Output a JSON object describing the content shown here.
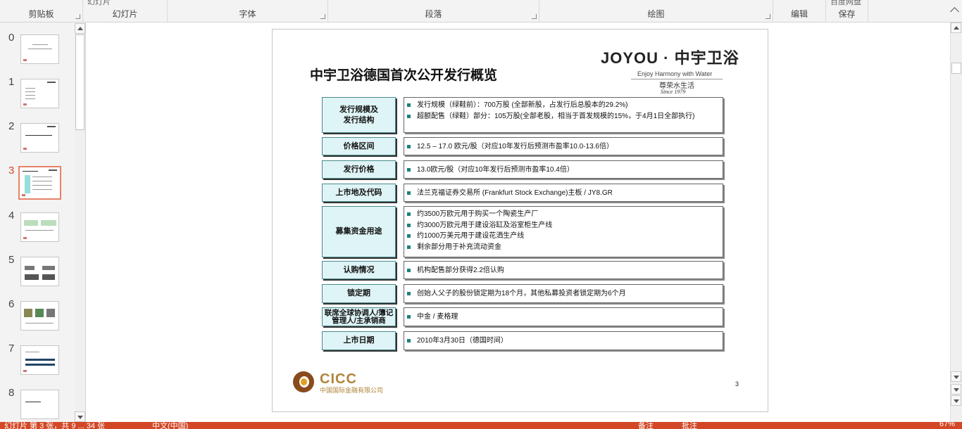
{
  "ribbon": {
    "groups": [
      {
        "label": "剪贴板"
      },
      {
        "label": "幻灯片"
      },
      {
        "label": "字体"
      },
      {
        "label": "段落"
      },
      {
        "label": "绘图"
      },
      {
        "label": "编辑"
      },
      {
        "label": "保存"
      }
    ],
    "partial_texts": {
      "slides_top": "幻灯片",
      "save_top": "百度网盘"
    }
  },
  "thumbnails": {
    "items": [
      {
        "num": "0"
      },
      {
        "num": "1"
      },
      {
        "num": "2"
      },
      {
        "num": "3"
      },
      {
        "num": "4"
      },
      {
        "num": "5"
      },
      {
        "num": "6"
      },
      {
        "num": "7"
      },
      {
        "num": "8"
      }
    ],
    "active_index": 3
  },
  "slide": {
    "title": "中宇卫浴德国首次公开发行概览",
    "brand": "JOYOU · 中宇卫浴",
    "tagline": "Enjoy Harmony with Water",
    "subtag": "尊荣水生活",
    "since": "Since 1979",
    "rows": [
      {
        "label": "发行规模及\n发行结构",
        "bullets": [
          "发行规模（绿鞋前）：700万股 (全部新股，占发行后总股本的29.2%)",
          "超额配售（绿鞋）部分：105万股(全部老股，相当于首发规模的15%，于4月1日全部执行)"
        ]
      },
      {
        "label": "价格区间",
        "bullets": [
          "12.5 – 17.0 欧元/股（对应10年发行后预测市盈率10.0-13.6倍）"
        ]
      },
      {
        "label": "发行价格",
        "bullets": [
          "13.0欧元/股（对应10年发行后预测市盈率10.4倍）"
        ]
      },
      {
        "label": "上市地及代码",
        "bullets": [
          "法兰克福证券交易所 (Frankfurt Stock Exchange)主板 / JY8.GR"
        ]
      },
      {
        "label": "募集资金用途",
        "bullets": [
          "约3500万欧元用于购买一个陶瓷生产厂",
          "约3000万欧元用于建设浴缸及浴室柜生产线",
          "约1000万美元用于建设花洒生产线",
          "剩余部分用于补充流动资金"
        ]
      },
      {
        "label": "认购情况",
        "bullets": [
          "机构配售部分获得2.2倍认购"
        ]
      },
      {
        "label": "锁定期",
        "bullets": [
          "创始人父子的股份锁定期为18个月，其他私募投资者锁定期为6个月"
        ]
      },
      {
        "label": "联席全球协调人/簿记管理人/主承销商",
        "bullets": [
          "中金 / 麦格理"
        ]
      },
      {
        "label": "上市日期",
        "bullets": [
          "2010年3月30日（德国时间）"
        ]
      }
    ],
    "footer": {
      "cicc_name": "CICC",
      "cicc_cn": "中国国际金融有限公司",
      "page_number": "3"
    }
  },
  "status": {
    "slide_info": "幻灯片 第 3 张，共 9 ... 34 张",
    "language": "中文(中国)",
    "notes": "备注",
    "comments": "批注",
    "zoom": "67%"
  },
  "colors": {
    "accent": "#d24726",
    "table_fill": "#dff4f6",
    "bullet": "#1f7f7f",
    "cicc_gold": "#b0853a"
  }
}
